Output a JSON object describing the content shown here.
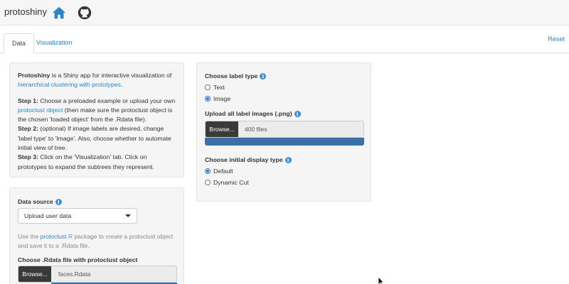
{
  "navbar": {
    "brand": "protoshiny",
    "home_icon": "home-icon",
    "github_icon": "github-icon"
  },
  "tabs": [
    {
      "label": "Data",
      "active": true
    },
    {
      "label": "Visualization",
      "active": false
    }
  ],
  "reset_label": "Reset",
  "intro": {
    "app_name": "Protoshiny",
    "line1_rest": " is a Shiny app for interactive visualization of",
    "link1": "hierarchical clustering with prototypes",
    "line1_end": ".",
    "step1_label": "Step 1:",
    "step1_text_a": " Choose a preloaded example or upload your own",
    "step1_link": "protoclust object",
    "step1_text_b": " (then make sure the protoclust object is the chosen 'loaded object' from the .Rdata file).",
    "step2_label": "Step 2:",
    "step2_text": " (optional) If image labels are desired, change 'label type' to 'Image'. Also, choose whether to automate initial view of tree.",
    "step3_label": "Step 3:",
    "step3_text": " Click on the 'Visualization' tab. Click on prototypes to expand the subtrees they represent."
  },
  "data_source": {
    "label": "Data source",
    "selected": "Upload user data",
    "help_prefix": "Use the ",
    "help_link": "protoclust",
    "help_suffix": " R package to create a protoclust object and save it to a .Rdata file.",
    "file_label": "Choose .Rdata file with protoclust object",
    "browse_label": "Browse...",
    "file_value": "faces.Rdata"
  },
  "label_type": {
    "label": "Choose label type",
    "options": [
      "Text",
      "Image"
    ],
    "selected": "Image"
  },
  "upload_images": {
    "label": "Upload all label images (.png)",
    "browse_label": "Browse...",
    "file_value": "400 files",
    "progress": 1.0
  },
  "display_type": {
    "label": "Choose initial display type",
    "options": [
      "Default",
      "Dynamic Cut"
    ],
    "selected": "Default"
  },
  "colors": {
    "link": "#2a84c9",
    "browse_bg": "#3a3a3a",
    "progress": "#3b6fa8",
    "info": "#3e8ddd"
  }
}
